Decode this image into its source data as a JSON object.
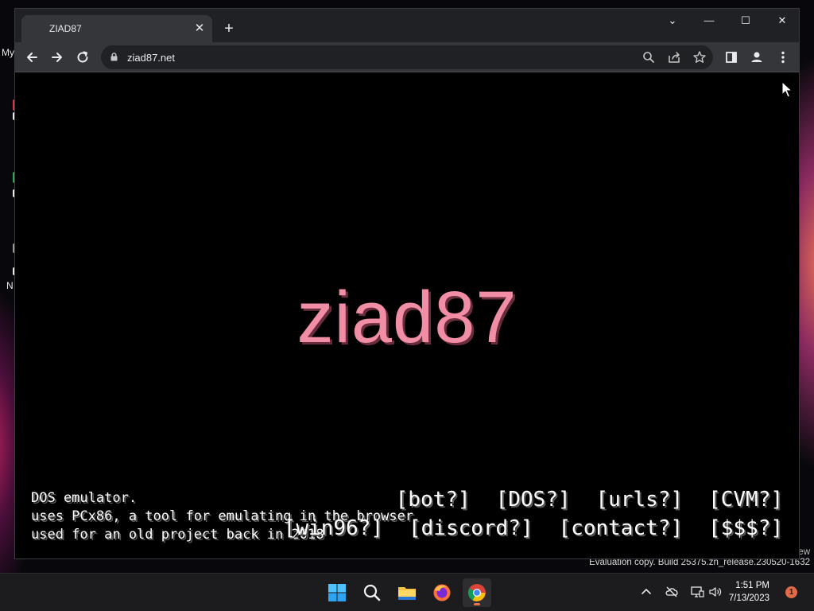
{
  "desktop": {
    "icon_fragments": [
      "My",
      "N"
    ],
    "watermark_line1": "ew",
    "watermark_line2": "Evaluation copy. Build 25375.zn_release.230520-1632"
  },
  "browser": {
    "tab": {
      "title": "ZIAD87",
      "close_glyph": "✕"
    },
    "new_tab_glyph": "+",
    "window_controls": {
      "tab_search_glyph": "⌄",
      "minimize_glyph": "—",
      "maximize_glyph": "☐",
      "close_glyph": "✕"
    },
    "address_bar": {
      "url": "ziad87.net"
    }
  },
  "page": {
    "logo": "ziad87",
    "description_lines": [
      "DOS emulator.",
      "uses PCx86, a tool for emulating in the browser",
      "used for an old project back in 2018"
    ],
    "links_row1": [
      "[bot?]",
      "[DOS?]",
      "[urls?]",
      "[CVM?]"
    ],
    "links_row2": [
      "[win96?]",
      "[discord?]",
      "[contact?]",
      "[$$$?]"
    ]
  },
  "taskbar": {
    "apps": [
      "start-icon",
      "search-icon",
      "file-explorer-icon",
      "firefox-icon",
      "chrome-icon"
    ],
    "clock": {
      "time": "1:51 PM",
      "date": "7/13/2023"
    },
    "notification_count": "1"
  },
  "colors": {
    "logo": "#f28da6",
    "page_background": "#000000",
    "chrome_frame": "#202124",
    "chrome_toolbar": "#35363a",
    "accent_orange": "#e6744f"
  }
}
